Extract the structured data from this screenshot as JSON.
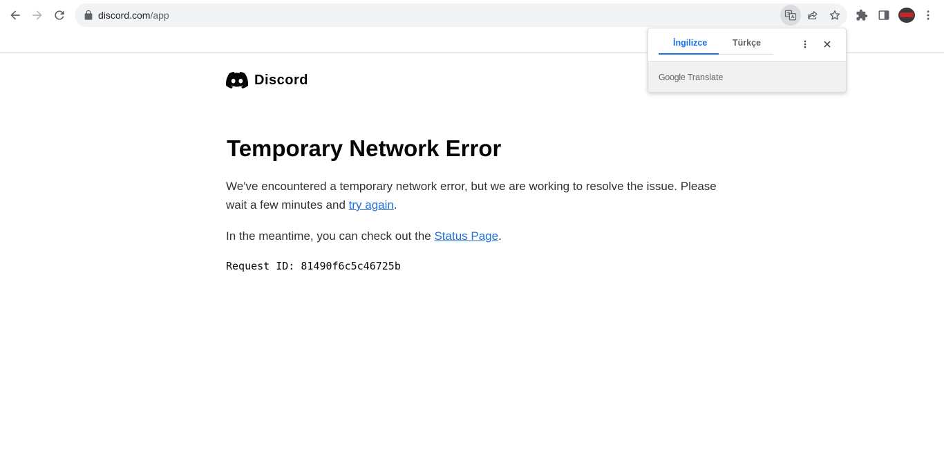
{
  "browser": {
    "url_host": "discord.com",
    "url_path": "/app"
  },
  "page": {
    "brand_name": "Discord",
    "headline": "Temporary Network Error",
    "para1_text": "We've encountered a temporary network error, but we are working to resolve the issue. Please wait a few minutes and ",
    "para1_link": "try again",
    "para1_end": ".",
    "para2_text": "In the meantime, you can check out the ",
    "para2_link": "Status Page",
    "para2_end": ".",
    "request_label": "Request ID:",
    "request_id": "81490f6c5c46725b"
  },
  "translate": {
    "tab_source": "İngilizce",
    "tab_target": "Türkçe",
    "brand_google": "Google",
    "brand_translate": "Translate"
  },
  "colors": {
    "link": "#1e6fd9",
    "translate_active": "#1a73e8"
  }
}
